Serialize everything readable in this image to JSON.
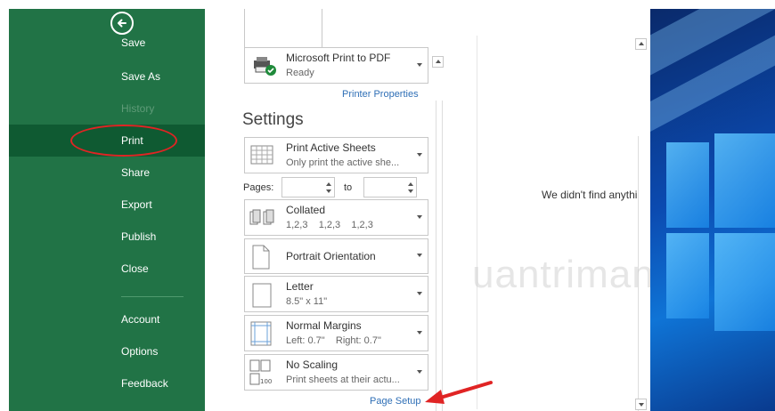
{
  "nav": {
    "items": [
      {
        "label": "Save"
      },
      {
        "label": "Save As"
      },
      {
        "label": "History"
      },
      {
        "label": "Print"
      },
      {
        "label": "Share"
      },
      {
        "label": "Export"
      },
      {
        "label": "Publish"
      },
      {
        "label": "Close"
      },
      {
        "label": "Account"
      },
      {
        "label": "Options"
      },
      {
        "label": "Feedback"
      }
    ],
    "selected": "Print"
  },
  "printer": {
    "name": "Microsoft Print to PDF",
    "status": "Ready",
    "properties_link": "Printer Properties"
  },
  "settings": {
    "heading": "Settings",
    "what_to_print": {
      "title": "Print Active Sheets",
      "sub": "Only print the active she..."
    },
    "pages_label": "Pages:",
    "to_label": "to",
    "pages_from": "",
    "pages_to": "",
    "collation": {
      "title": "Collated",
      "sub": "1,2,3    1,2,3    1,2,3"
    },
    "orientation": {
      "title": "Portrait Orientation"
    },
    "paper": {
      "title": "Letter",
      "sub": "8.5\" x 11\""
    },
    "margins": {
      "title": "Normal Margins",
      "sub": "Left: 0.7\"    Right: 0.7\""
    },
    "scaling": {
      "title": "No Scaling",
      "sub": "Print sheets at their actu..."
    },
    "page_setup_link": "Page Setup"
  },
  "preview": {
    "message": "We didn't find anythi"
  },
  "watermark": "uantrimang",
  "colors": {
    "nav_green": "#217346",
    "highlight_green": "#0f5a32",
    "annotation_red": "#e02424",
    "link_blue": "#2f6fb6"
  }
}
